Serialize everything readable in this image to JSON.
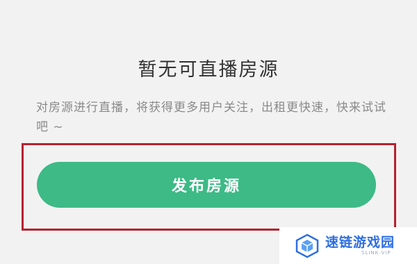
{
  "empty_state": {
    "title": "暂无可直播房源",
    "description": "对房源进行直播，将获得更多用户关注，出租更快速，快来试试吧 ~"
  },
  "actions": {
    "publish_label": "发布房源"
  },
  "watermark": {
    "name": "速链游戏园",
    "domain": "SLINK.VIP"
  },
  "colors": {
    "background": "#f2f2f2",
    "button": "#3dba86",
    "highlight": "#b5212e",
    "watermark_blue": "#2e6fe0"
  }
}
